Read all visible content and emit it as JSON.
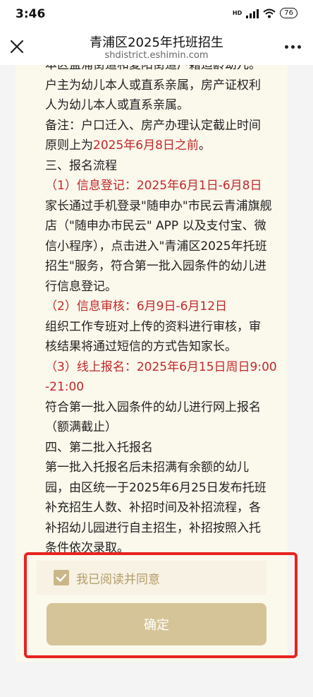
{
  "status": {
    "time": "3:46",
    "network": "HD",
    "battery": "76"
  },
  "header": {
    "title": "青浦区2025年托班招生",
    "subtitle": "shdistrict.eshimin.com"
  },
  "article": {
    "lines": [
      [
        {
          "t": "本区盈浦街道和夏阳街道户籍适龄幼儿。",
          "r": false
        }
      ],
      [
        {
          "t": "户主为幼儿本人或直系亲属，房产证权利",
          "r": false
        }
      ],
      [
        {
          "t": "人为幼儿本人或直系亲属。",
          "r": false
        }
      ],
      [
        {
          "t": "备注：户口迁入、房产办理认定截止时间",
          "r": false
        }
      ],
      [
        {
          "t": "原则上为",
          "r": false
        },
        {
          "t": "2025年6月8日之前",
          "r": true
        },
        {
          "t": "。",
          "r": false
        }
      ],
      [
        {
          "t": "三、报名流程",
          "r": false
        }
      ],
      [
        {
          "t": "（1）信息登记：2025年6月1日-6月8日",
          "r": true
        }
      ],
      [
        {
          "t": "家长通过手机登录\"随申办\"市民云青浦旗舰",
          "r": false
        }
      ],
      [
        {
          "t": "店（\"随申办市民云\" APP 以及支付宝、微",
          "r": false
        }
      ],
      [
        {
          "t": "信小程序），点击进入\"青浦区2025年托班",
          "r": false
        }
      ],
      [
        {
          "t": "招生\"服务，符合第一批入园条件的幼儿进",
          "r": false
        }
      ],
      [
        {
          "t": "行信息登记。",
          "r": false
        }
      ],
      [
        {
          "t": "（2）信息审核：6月9日-6月12日",
          "r": true
        }
      ],
      [
        {
          "t": "组织工作专班对上传的资料进行审核，审",
          "r": false
        }
      ],
      [
        {
          "t": "核结果将通过短信的方式告知家长。",
          "r": false
        }
      ],
      [
        {
          "t": "（3）线上报名：2025年6月15日周日9:00",
          "r": true
        }
      ],
      [
        {
          "t": "-21:00",
          "r": true
        }
      ],
      [
        {
          "t": "符合第一批入园条件的幼儿进行网上报名",
          "r": false
        }
      ],
      [
        {
          "t": "（额满截止）",
          "r": false
        }
      ],
      [
        {
          "t": "四、第二批入托报名",
          "r": false
        }
      ],
      [
        {
          "t": "第一批入托报名后未招满有余额的幼儿",
          "r": false
        }
      ],
      [
        {
          "t": "园，由区统一于2025年6月25日发布托班",
          "r": false
        }
      ],
      [
        {
          "t": "补充招生人数、补招时间及补招流程，各",
          "r": false
        }
      ],
      [
        {
          "t": "补招幼儿园进行自主招生，补招按照入托",
          "r": false
        }
      ],
      [
        {
          "t": "条件依次录取。",
          "r": false
        }
      ]
    ]
  },
  "agree": {
    "label": "我已阅读并同意",
    "checked": true
  },
  "confirm": {
    "label": "确定"
  },
  "colors": {
    "accent": "#d5c497",
    "highlight": "#e8231f",
    "emphasis": "#c0282a"
  }
}
